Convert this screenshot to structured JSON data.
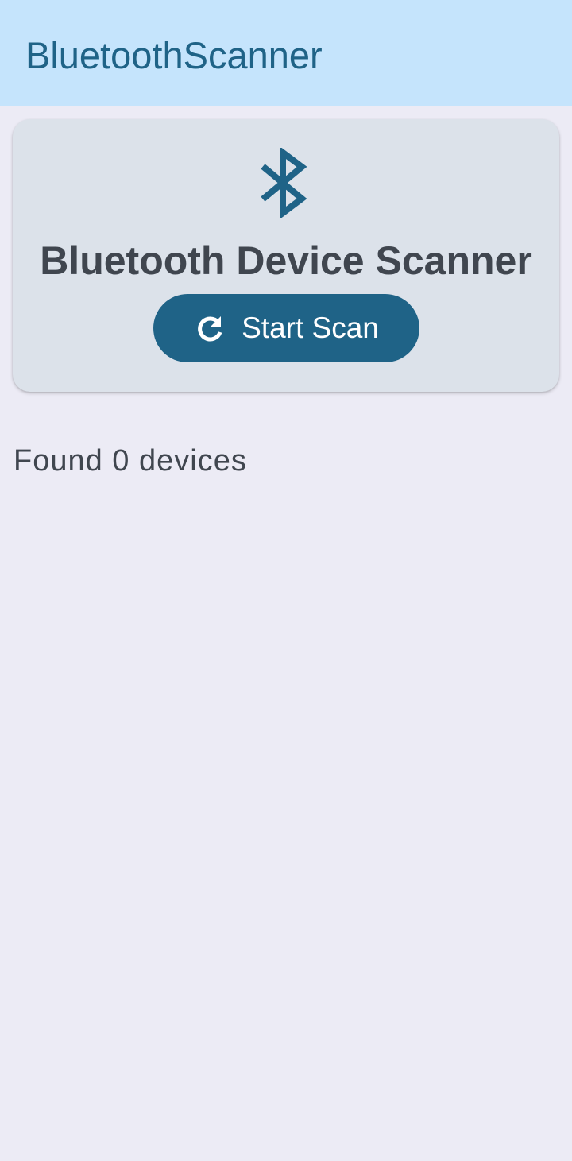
{
  "app_bar": {
    "title": "BluetoothScanner",
    "background": "#C5E4FC",
    "title_color": "#1F6387"
  },
  "scanner_card": {
    "icon": "bluetooth-icon",
    "heading": "Bluetooth Device Scanner",
    "scan_button": {
      "icon": "refresh-icon",
      "label": "Start Scan",
      "background": "#1F6387"
    }
  },
  "results": {
    "count_text": "Found 0 devices",
    "devices": []
  },
  "colors": {
    "page_background": "#ECEBF5",
    "card_background": "#DCE2EA",
    "text_dark": "#40464F",
    "accent": "#1F6387"
  }
}
